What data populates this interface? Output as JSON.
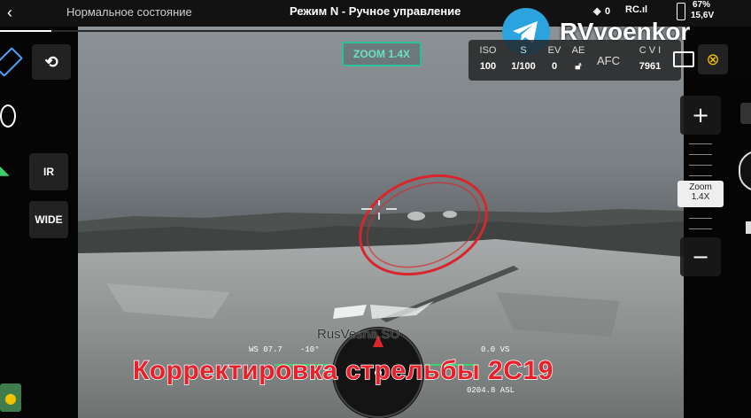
{
  "topbar": {
    "status": "Нормальное состояние",
    "mode": "Режим N - Ручное управление",
    "signal_count": "0",
    "rc_label": "RC.ıl",
    "battery_percent": "67%",
    "battery_voltage": "15,6V"
  },
  "channel": {
    "name": "RVvoenkor",
    "icon": "telegram-icon"
  },
  "zoom_badge": "ZOOM 1.4X",
  "camera": {
    "iso_label": "ISO",
    "iso_value": "100",
    "shutter_label": "S",
    "shutter_value": "1/100",
    "ev_label": "EV",
    "ev_value": "0",
    "ae_label": "AE",
    "af_label": "AFC",
    "storage_label": "C V I",
    "storage_value": "7961"
  },
  "side_buttons": {
    "ir": "IR",
    "wide": "WIDE"
  },
  "zoom": {
    "plus": "+",
    "minus": "−",
    "label": "Zoom",
    "value": "1.4X",
    "level": 0.4
  },
  "hud": {
    "ws": "WS 07.7",
    "heading": "-10°",
    "vs": "0.0 VS",
    "asl": "0204.8 ASL"
  },
  "watermark": "RusVesna.SU",
  "subtitle": "Корректировка стрельбы 2С19",
  "colors": {
    "target_ring": "#d9262c",
    "subtitle": "#e8202a",
    "accent": "#f2c200",
    "telegram": "#2aa3de"
  }
}
